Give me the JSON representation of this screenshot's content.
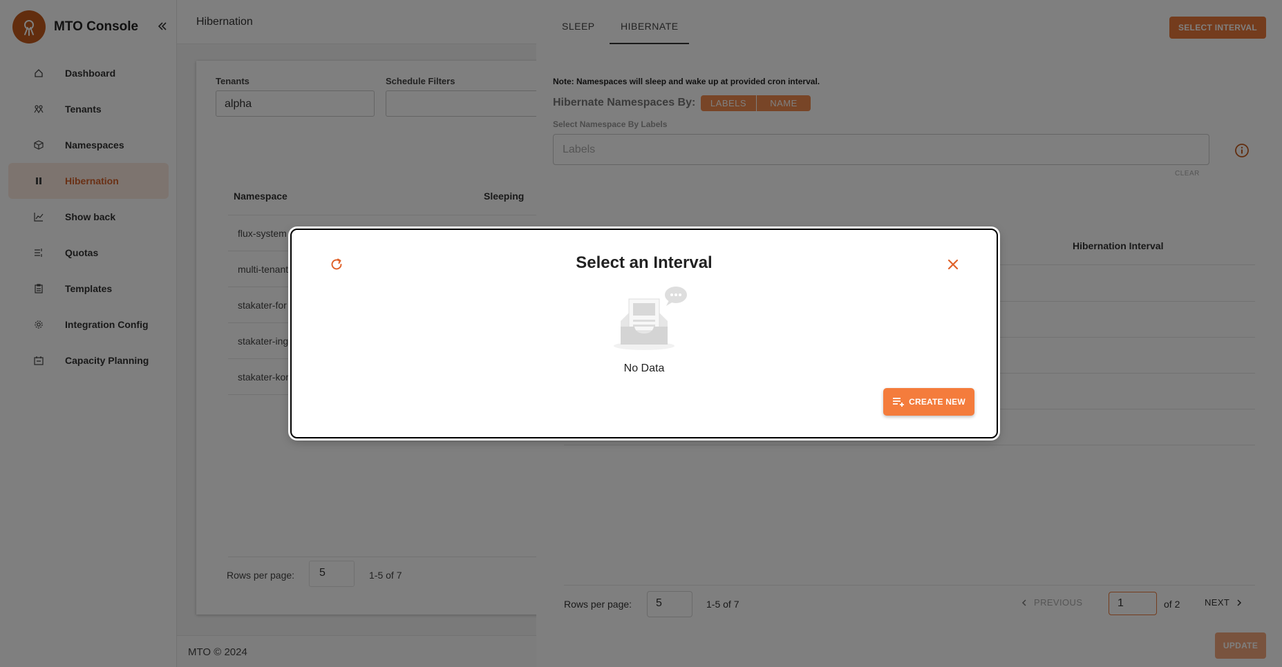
{
  "app": {
    "title": "MTO Console"
  },
  "sidebar": {
    "items": [
      {
        "label": "Dashboard",
        "icon": "home-icon"
      },
      {
        "label": "Tenants",
        "icon": "tenants-icon"
      },
      {
        "label": "Namespaces",
        "icon": "cube-icon"
      },
      {
        "label": "Hibernation",
        "icon": "pause-icon",
        "active": true
      },
      {
        "label": "Show back",
        "icon": "chart-icon"
      },
      {
        "label": "Quotas",
        "icon": "quota-icon"
      },
      {
        "label": "Templates",
        "icon": "clipboard-icon"
      },
      {
        "label": "Integration Config",
        "icon": "gear-icon"
      },
      {
        "label": "Capacity Planning",
        "icon": "planning-icon"
      }
    ]
  },
  "header": {
    "title": "Hibernation"
  },
  "filters": {
    "tenants_label": "Tenants",
    "tenants_value": "alpha",
    "schedule_label": "Schedule Filters"
  },
  "table": {
    "headers": [
      "Namespace",
      "Sleeping"
    ],
    "rows": [
      "flux-system",
      "multi-tenant",
      "stakater-for",
      "stakater-ing",
      "stakater-kor"
    ],
    "rows_per_page_label": "Rows per page:",
    "rows_per_page": "5",
    "range": "1-5 of 7"
  },
  "footer": {
    "text": "MTO © 2024"
  },
  "drawer": {
    "tabs": [
      "SLEEP",
      "HIBERNATE"
    ],
    "active_tab": "HIBERNATE",
    "select_interval_button": "SELECT INTERVAL",
    "note": "Note: Namespaces will sleep and wake up at provided cron interval.",
    "hibernate_by_label": "Hibernate Namespaces By:",
    "hibernate_by_options": [
      "LABELS",
      "NAME"
    ],
    "select_by_labels_label": "Select Namespace By Labels",
    "labels_placeholder": "Labels",
    "clear_label": "CLEAR",
    "table_header": "Hibernation Interval",
    "rows_per_page_label": "Rows per page:",
    "rows_per_page": "5",
    "range": "1-5 of 7",
    "previous_label": "PREVIOUS",
    "page": "1",
    "of_pages": "of 2",
    "next_label": "NEXT",
    "update_button": "UPDATE"
  },
  "modal": {
    "title": "Select an Interval",
    "empty_text": "No Data",
    "create_button": "CREATE NEW"
  },
  "colors": {
    "accent": "#e8793a",
    "accent_dark": "#c45a1c",
    "active_bg": "#fbe9de"
  }
}
